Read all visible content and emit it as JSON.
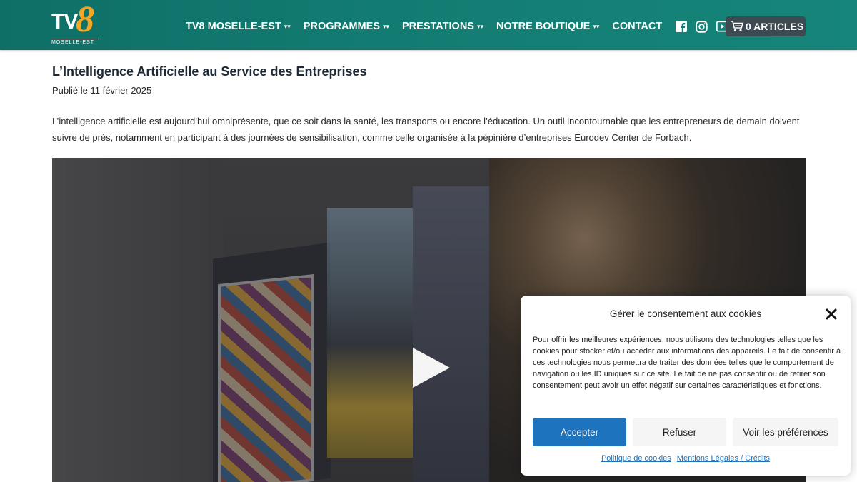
{
  "logo": {
    "tv": "TV",
    "eight": "8",
    "sub": "MOSELLE-EST"
  },
  "nav": [
    {
      "label": "TV8 MOSELLE-EST",
      "dropdown": true
    },
    {
      "label": "PROGRAMMES",
      "dropdown": true
    },
    {
      "label": "PRESTATIONS",
      "dropdown": true
    },
    {
      "label": "NOTRE BOUTIQUE",
      "dropdown": true
    },
    {
      "label": "CONTACT",
      "dropdown": false
    }
  ],
  "nav_chevron": "⌄",
  "social_icons": [
    "facebook-icon",
    "instagram-icon",
    "youtube-icon",
    "search-icon"
  ],
  "cart": {
    "label": "0 ARTICLES",
    "icon": "cart-icon"
  },
  "article": {
    "title": "L’Intelligence Artificielle au Service des Entreprises",
    "date": "Publié le 11 février 2025",
    "lede": "L’intelligence artificielle est aujourd’hui omniprésente, que ce soit dans la santé, les transports ou encore l’éducation. Un outil incontournable que les entrepreneurs de demain doivent suivre de près, notamment en participant à des journées de sensibilisation, comme celle organisée à la pépinière d’entreprises Eurodev Center de Forbach."
  },
  "video": {
    "play_icon": "play-icon"
  },
  "cookie": {
    "title": "Gérer le consentement aux cookies",
    "text": "Pour offrir les meilleures expériences, nous utilisons des technologies telles que les cookies pour stocker et/ou accéder aux informations des appareils. Le fait de consentir à ces technologies nous permettra de traiter des données telles que le comportement de navigation ou les ID uniques sur ce site. Le fait de ne pas consentir ou de retirer son consentement peut avoir un effet négatif sur certaines caractéristiques et fonctions.",
    "accept": "Accepter",
    "refuse": "Refuser",
    "prefs": "Voir les préférences",
    "link_cookies": "Politique de cookies",
    "link_legal": "Mentions Légales / Crédits"
  },
  "colors": {
    "header": "#137c72",
    "accent": "#f5a623",
    "button": "#1e73be",
    "cart_bg": "#3d4a52"
  }
}
